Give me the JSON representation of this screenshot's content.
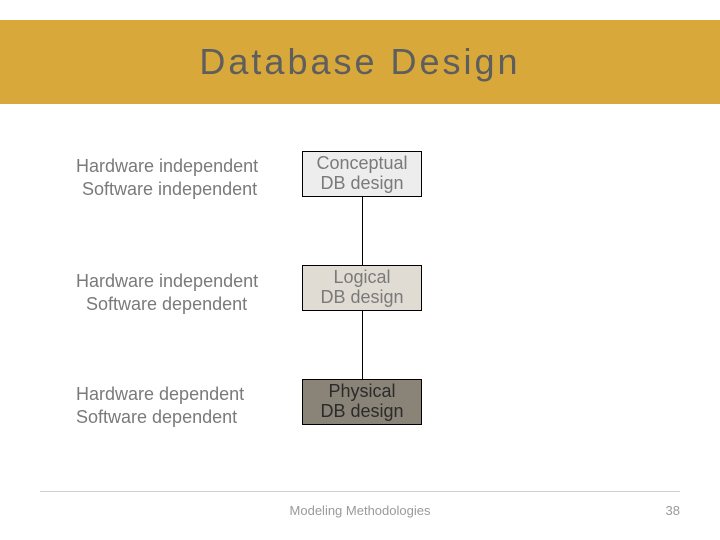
{
  "title": "Database Design",
  "stages": [
    {
      "label_line1": "Hardware independent",
      "label_line2": "Software independent",
      "box_line1": "Conceptual",
      "box_line2": "DB design"
    },
    {
      "label_line1": "Hardware independent",
      "label_line2": "Software dependent",
      "box_line1": "Logical",
      "box_line2": "DB design"
    },
    {
      "label_line1": "Hardware dependent",
      "label_line2": "Software dependent",
      "box_line1": "Physical",
      "box_line2": "DB design"
    }
  ],
  "footer": "Modeling Methodologies",
  "page_number": "38"
}
